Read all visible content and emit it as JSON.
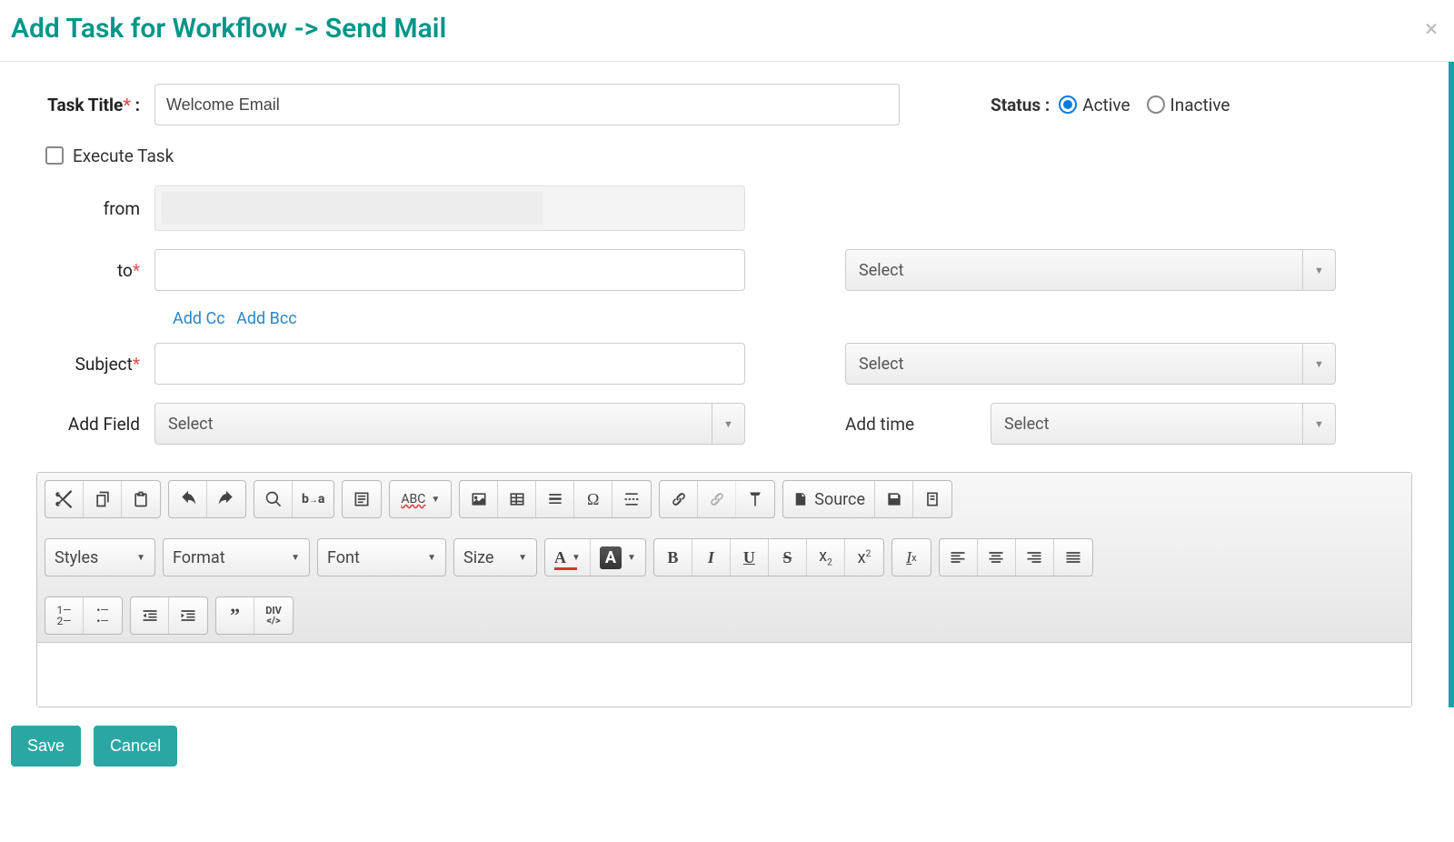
{
  "header": {
    "title": "Add Task for Workflow -> Send Mail"
  },
  "task_title": {
    "label": "Task Title",
    "value": "Welcome Email"
  },
  "status": {
    "label": "Status :",
    "active_label": "Active",
    "inactive_label": "Inactive",
    "active_checked": true
  },
  "execute": {
    "label": "Execute Task",
    "checked": false
  },
  "from": {
    "label": "from"
  },
  "to": {
    "label": "to",
    "value": ""
  },
  "to_select": {
    "placeholder": "Select"
  },
  "cc_link": "Add Cc",
  "bcc_link": "Add Bcc",
  "subject": {
    "label": "Subject",
    "value": ""
  },
  "subject_select": {
    "placeholder": "Select"
  },
  "add_field": {
    "label": "Add Field",
    "placeholder": "Select"
  },
  "add_time": {
    "label": "Add time",
    "placeholder": "Select"
  },
  "editor": {
    "source_label": "Source",
    "styles": "Styles",
    "format": "Format",
    "font": "Font",
    "size": "Size",
    "abc": "ABC"
  },
  "footer": {
    "save": "Save",
    "cancel": "Cancel"
  }
}
